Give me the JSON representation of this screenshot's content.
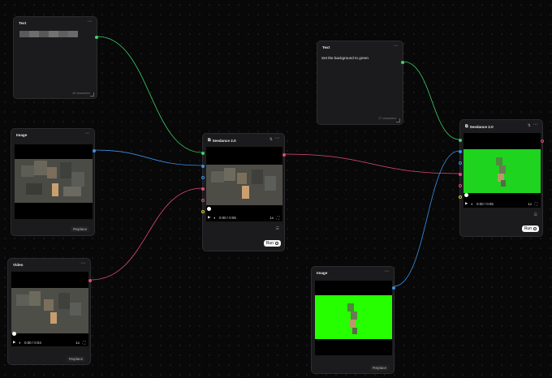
{
  "colors": {
    "text_port": "#3fd06a",
    "image_port": "#3b8ee8",
    "video_port": "#e04a7b",
    "green_screen": "#1ed41e",
    "bright_green": "#26ff00",
    "audio_port": "#d6c93a"
  },
  "nodes": {
    "text1": {
      "title": "Text",
      "char_count": "40 characters"
    },
    "image1": {
      "title": "Image",
      "replace_label": "Replace"
    },
    "video1": {
      "title": "Video",
      "time": "0:00 / 0:04",
      "speed": "1x",
      "replace_label": "Replace"
    },
    "seedance1": {
      "title": "Seedance 2.0",
      "time": "0:00 / 0:05",
      "speed": "1x",
      "run_label": "Run"
    },
    "text2": {
      "title": "Text",
      "prompt": "Set the background to green",
      "char_count": "27 characters"
    },
    "seedance2": {
      "title": "Seedance 2.0",
      "time": "0:00 / 0:05",
      "speed": "1x",
      "run_label": "Run"
    },
    "image2": {
      "title": "Image",
      "replace_label": "Replace"
    }
  },
  "icons": {
    "menu": "more-dots-icon",
    "play": "play-icon",
    "volume": "volume-icon",
    "fullscreen": "fullscreen-icon",
    "settings": "sliders-icon",
    "expand": "expand-icon",
    "model": "model-icon"
  }
}
